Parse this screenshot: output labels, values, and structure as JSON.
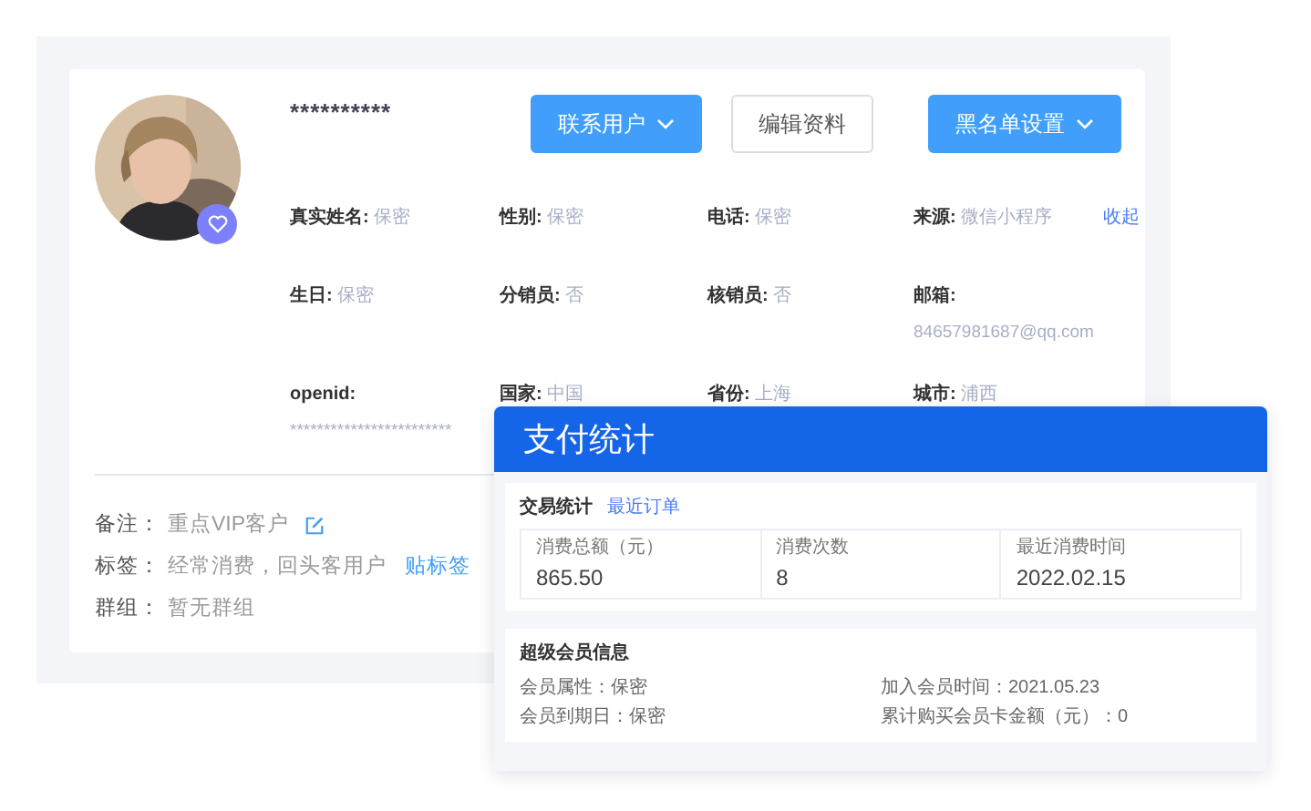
{
  "profile": {
    "name": "**********"
  },
  "buttons": [
    {
      "label": "联系用户",
      "kind": "primary",
      "caret": true
    },
    {
      "label": "编辑资料",
      "kind": "outline",
      "caret": false
    },
    {
      "label": "黑名单设置",
      "kind": "primary",
      "caret": true
    }
  ],
  "fields": [
    {
      "items": [
        {
          "label": "真实姓名:",
          "value": "保密",
          "kind": "inline"
        },
        {
          "label": "性别:",
          "value": "保密",
          "kind": "inline"
        },
        {
          "label": "电话:",
          "value": "保密",
          "kind": "inline"
        },
        {
          "label": "来源:",
          "value": "微信小程序",
          "kind": "inline"
        }
      ],
      "action": "收起"
    },
    {
      "items": [
        {
          "label": "生日:",
          "value": "保密",
          "kind": "inline"
        },
        {
          "label": "分销员:",
          "value": "否",
          "kind": "inline"
        },
        {
          "label": "核销员:",
          "value": "否",
          "kind": "inline"
        },
        {
          "label": "邮箱:",
          "value": "84657981687@qq.com",
          "kind": "stacked"
        }
      ]
    },
    {
      "items": [
        {
          "label": "openid:",
          "value": "************************",
          "kind": "stacked"
        },
        {
          "label": "国家:",
          "value": "中国",
          "kind": "inline"
        },
        {
          "label": "省份:",
          "value": "上海",
          "kind": "inline"
        },
        {
          "label": "城市:",
          "value": "浦西",
          "kind": "inline"
        }
      ]
    }
  ],
  "notes": [
    {
      "label": "备注：",
      "value": "重点VIP客户",
      "kind": "edit"
    },
    {
      "label": "标签：",
      "value": "经常消费，回头客用户",
      "kind": "link",
      "link": "贴标签"
    },
    {
      "label": "群组：",
      "value": "暂无群组",
      "kind": "plain"
    }
  ],
  "payment_panel": {
    "title": "支付统计",
    "trade": {
      "title": "交易统计",
      "link": "最近订单",
      "stats": [
        {
          "label": "消费总额（元）",
          "value": "865.50"
        },
        {
          "label": "消费次数",
          "value": "8"
        },
        {
          "label": "最近消费时间",
          "value": "2022.02.15"
        }
      ]
    },
    "member": {
      "title": "超级会员信息",
      "items": [
        "会员属性：保密",
        "加入会员时间：2021.05.23",
        "会员到期日：保密",
        "累计购买会员卡金额（元）：0"
      ]
    }
  }
}
